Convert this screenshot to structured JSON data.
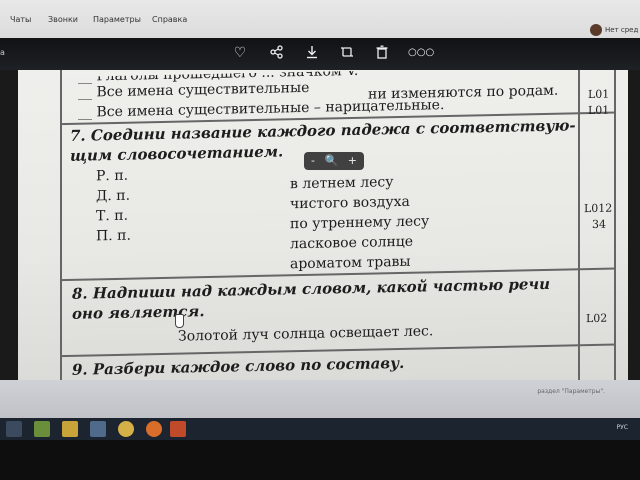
{
  "menubar": {
    "items": [
      "Чаты",
      "Звонки",
      "Параметры",
      "Справка"
    ],
    "account_label": "Нет сред"
  },
  "viewer": {
    "left_label": "а",
    "icons": [
      "heart-icon",
      "share-icon",
      "download-icon",
      "crop-icon",
      "trash-icon",
      "more-icon"
    ],
    "zoom_out": "-",
    "zoom_in": "+"
  },
  "document": {
    "line_top_cut": "__ Глаголы прошедшего ... значком V.",
    "line_nouns": "__ Все имена существительные – нарицательные.",
    "line_nouns_pre": "__ Все имена существительные",
    "line_nouns_mid": "ни изменяются по родам.",
    "code_l01a": "L01",
    "code_l01b": "L01",
    "task7_line1": "7. Соедини название каждого падежа с соответствую-",
    "task7_line2": "щим словосочетанием.",
    "cases": [
      "Р. п.",
      "Д. п.",
      "Т. п.",
      "П. п."
    ],
    "phrases": [
      "в летнем лесу",
      "чистого воздуха",
      "по утреннему лесу",
      "ласковое солнце",
      "ароматом травы"
    ],
    "code_l012": "L012",
    "code_34": "34",
    "task8_line1": "8. Надпиши над каждым словом, какой частью речи",
    "task8_line2": "оно является.",
    "sentence": "Золотой луч солнца освещает лес.",
    "code_l02": "L02",
    "task9": "9. Разбери каждое слово по составу."
  },
  "system": {
    "activate_text": "раздел \"Параметры\".",
    "tray_text": "РУС"
  }
}
